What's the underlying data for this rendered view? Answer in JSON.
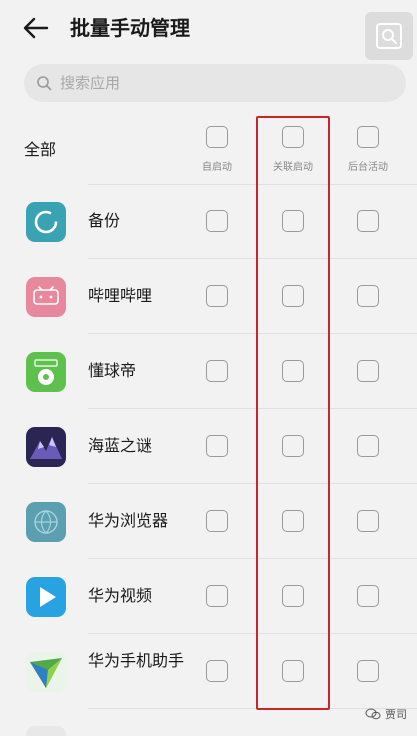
{
  "header": {
    "title": "批量手动管理",
    "back_icon": "arrow-left-icon",
    "corner_icon": "search-icon"
  },
  "search": {
    "placeholder": "搜索应用",
    "value": ""
  },
  "all_row": {
    "label": "全部",
    "columns": [
      "自启动",
      "关联启动",
      "后台活动"
    ]
  },
  "apps": [
    {
      "name": "备份",
      "icon": "backup-icon",
      "color": "#3aa3b3"
    },
    {
      "name": "哔哩哔哩",
      "icon": "bilibili-icon",
      "color": "#e7889c"
    },
    {
      "name": "懂球帝",
      "icon": "dongqiudi-icon",
      "color": "#5ec14e"
    },
    {
      "name": "海蓝之谜",
      "icon": "game-icon",
      "color": "#2a2553"
    },
    {
      "name": "华为浏览器",
      "icon": "browser-icon",
      "color": "#5b9fb0"
    },
    {
      "name": "华为视频",
      "icon": "video-icon",
      "color": "#26a3e0"
    },
    {
      "name": "华为手机助手",
      "icon": "phone-assistant-icon",
      "color": "#52a948"
    }
  ],
  "watermark": {
    "text": "贾司"
  },
  "colors": {
    "highlight": "#c62828",
    "background": "#f2f2f2"
  }
}
